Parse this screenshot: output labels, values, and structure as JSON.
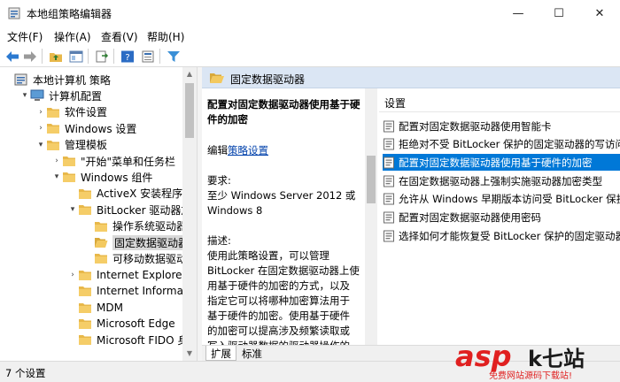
{
  "window": {
    "title": "本地组策略编辑器"
  },
  "controls": {
    "minimize": "—",
    "maximize": "☐",
    "close": "✕"
  },
  "menu": [
    "文件(F)",
    "操作(A)",
    "查看(V)",
    "帮助(H)"
  ],
  "tree": [
    {
      "label": "本地计算机 策略",
      "level": 0,
      "arrow": "",
      "icon": "policy-icon"
    },
    {
      "label": "计算机配置",
      "level": 1,
      "arrow": "▾",
      "icon": "computer-icon"
    },
    {
      "label": "软件设置",
      "level": 2,
      "arrow": "›",
      "icon": "folder-icon"
    },
    {
      "label": "Windows 设置",
      "level": 2,
      "arrow": "›",
      "icon": "folder-icon"
    },
    {
      "label": "管理模板",
      "level": 2,
      "arrow": "▾",
      "icon": "folder-icon"
    },
    {
      "label": "\"开始\"菜单和任务栏",
      "level": 3,
      "arrow": "›",
      "icon": "folder-icon"
    },
    {
      "label": "Windows 组件",
      "level": 3,
      "arrow": "▾",
      "icon": "folder-icon"
    },
    {
      "label": "ActiveX 安装程序服务",
      "level": 4,
      "arrow": "",
      "icon": "folder-icon"
    },
    {
      "label": "BitLocker 驱动器加密",
      "level": 4,
      "arrow": "▾",
      "icon": "folder-icon"
    },
    {
      "label": "操作系统驱动器",
      "level": 5,
      "arrow": "",
      "icon": "folder-icon"
    },
    {
      "label": "固定数据驱动器",
      "level": 5,
      "arrow": "",
      "icon": "folder-open-icon",
      "selected": true
    },
    {
      "label": "可移动数据驱动器",
      "level": 5,
      "arrow": "",
      "icon": "folder-icon"
    },
    {
      "label": "Internet Explorer",
      "level": 4,
      "arrow": "›",
      "icon": "folder-icon"
    },
    {
      "label": "Internet Information",
      "level": 4,
      "arrow": "",
      "icon": "folder-icon"
    },
    {
      "label": "MDM",
      "level": 4,
      "arrow": "",
      "icon": "folder-icon"
    },
    {
      "label": "Microsoft Edge",
      "level": 4,
      "arrow": "",
      "icon": "folder-icon"
    },
    {
      "label": "Microsoft FIDO 身份验",
      "level": 4,
      "arrow": "",
      "icon": "folder-icon"
    }
  ],
  "right": {
    "header": "固定数据驱动器",
    "desc": {
      "heading": "配置对固定数据驱动器使用基于硬件的加密",
      "edit_prefix": "编辑",
      "edit_link": "策略设置",
      "req_label": "要求:",
      "req_text": "至少 Windows Server 2012 或 Windows 8",
      "desc_label": "描述:",
      "desc_text": "使用此策略设置，可以管理 BitLocker 在固定数据驱动器上使用基于硬件的加密的方式，以及指定它可以将哪种加密算法用于基于硬件的加密。使用基于硬件的加密可以提高涉及频繁读取或写入驱动器数据的驱动器操作的性能。"
    },
    "list_header": "设置",
    "settings": [
      "配置对固定数据驱动器使用智能卡",
      "拒绝对不受 BitLocker 保护的固定驱动器的写访问",
      "配置对固定数据驱动器使用基于硬件的加密",
      "在固定数据驱动器上强制实施驱动器加密类型",
      "允许从 Windows 早期版本访问受 BitLocker 保护的",
      "配置对固定数据驱动器使用密码",
      "选择如何才能恢复受 BitLocker 保护的固定驱动器"
    ],
    "selected_setting": 2,
    "tabs": [
      "扩展",
      "标准"
    ]
  },
  "status": "7 个设置",
  "watermark": {
    "brand": "asp",
    "cn": "k七站",
    "sub": "免费网站源码下载站!"
  }
}
